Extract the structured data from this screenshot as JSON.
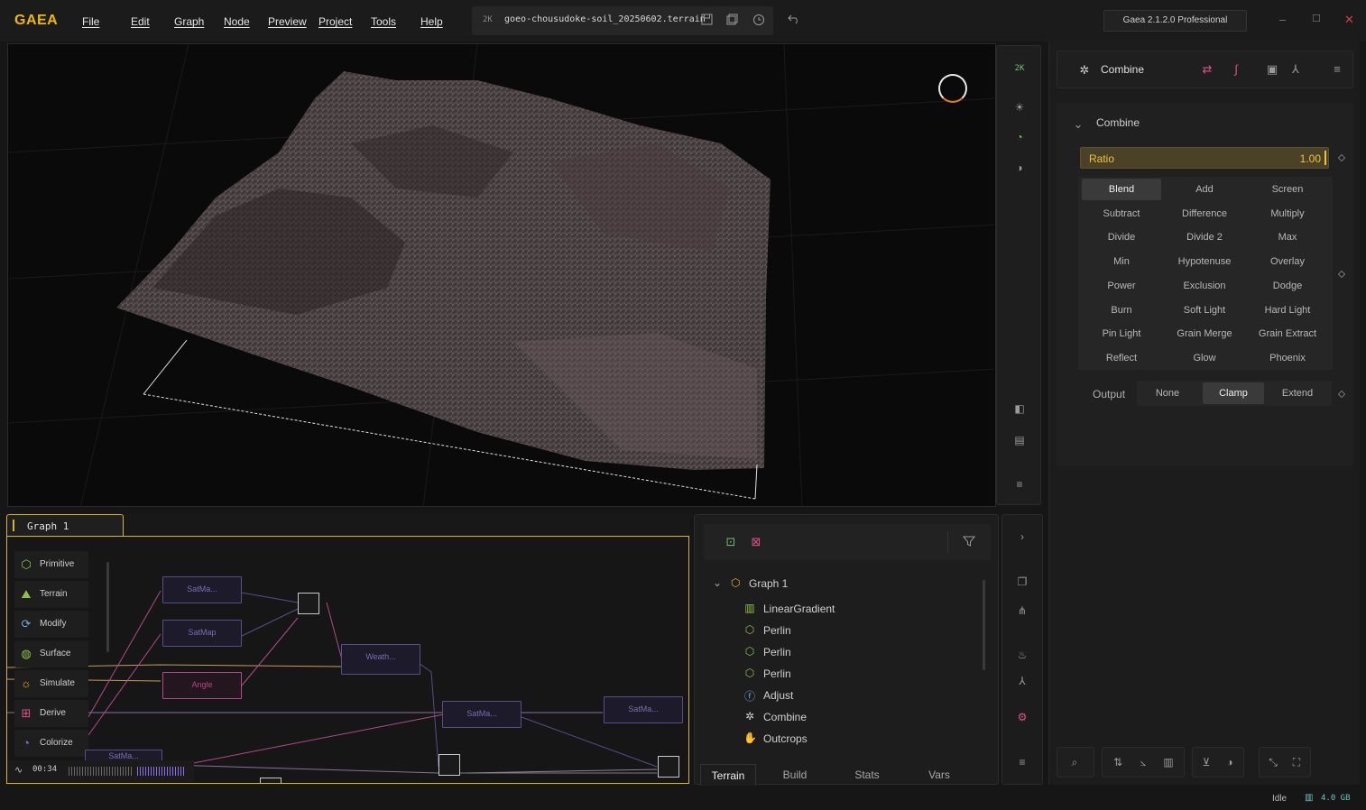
{
  "app": {
    "logo": "GAEA",
    "version": "Gaea 2.1.2.0 Professional"
  },
  "menu": [
    "File",
    "Edit",
    "Graph",
    "Node",
    "Preview",
    "Project",
    "Tools",
    "Help"
  ],
  "file": {
    "resolution": "2K",
    "name": "goeo-chousudoke-soil_20250602.terrain"
  },
  "viewport": {
    "toolbar_resolution": "2K"
  },
  "properties": {
    "node_name": "Combine",
    "section_title": "Combine",
    "ratio": {
      "label": "Ratio",
      "value": "1.00"
    },
    "blend_modes": [
      "Blend",
      "Add",
      "Screen",
      "Subtract",
      "Difference",
      "Multiply",
      "Divide",
      "Divide 2",
      "Max",
      "Min",
      "Hypotenuse",
      "Overlay",
      "Power",
      "Exclusion",
      "Dodge",
      "Burn",
      "Soft Light",
      "Hard Light",
      "Pin Light",
      "Grain Merge",
      "Grain Extract",
      "Reflect",
      "Glow",
      "Phoenix"
    ],
    "active_mode": "Blend",
    "output": {
      "label": "Output",
      "options": [
        "None",
        "Clamp",
        "Extend"
      ],
      "active": "Clamp"
    }
  },
  "graph": {
    "tab": "Graph 1",
    "palette": [
      {
        "label": "Primitive",
        "icon": "cube-icon",
        "color": "#8bc34a"
      },
      {
        "label": "Terrain",
        "icon": "mountain-icon",
        "color": "#8bc34a"
      },
      {
        "label": "Modify",
        "icon": "modify-icon",
        "color": "#6fa8dc"
      },
      {
        "label": "Surface",
        "icon": "surface-icon",
        "color": "#8bc34a"
      },
      {
        "label": "Simulate",
        "icon": "sun-icon",
        "color": "#f0b000"
      },
      {
        "label": "Derive",
        "icon": "derive-icon",
        "color": "#e0508a"
      },
      {
        "label": "Colorize",
        "icon": "colorize-icon",
        "color": "#8a6ef0"
      }
    ],
    "nodes": [
      "SatMa...",
      "SatMap",
      "Angle",
      "Weath...",
      "SatMa...",
      "SatMa...",
      "SatMa..."
    ],
    "timer": "00:34"
  },
  "explorer": {
    "root": "Graph 1",
    "items": [
      {
        "label": "LinearGradient",
        "icon": "gradient-icon",
        "color": "#8bc34a"
      },
      {
        "label": "Perlin",
        "icon": "hexagon-icon",
        "color": "#8bc34a"
      },
      {
        "label": "Perlin",
        "icon": "hexagon-icon",
        "color": "#8bc34a"
      },
      {
        "label": "Perlin",
        "icon": "hexagon-icon",
        "color": "#8bc34a"
      },
      {
        "label": "Adjust",
        "icon": "fx-icon",
        "color": "#6fa8dc"
      },
      {
        "label": "Combine",
        "icon": "combine-icon",
        "color": "#d0d0d0"
      },
      {
        "label": "Outcrops",
        "icon": "outcrops-icon",
        "color": "#8bc34a"
      }
    ],
    "tabs": [
      "Terrain",
      "Build",
      "Stats",
      "Vars"
    ],
    "active_tab": "Terrain"
  },
  "status": {
    "state": "Idle",
    "memory": "4.0 GB"
  },
  "colors": {
    "accent": "#f0b800",
    "node": "#5a4c88",
    "node_pink": "#b04a8a"
  }
}
